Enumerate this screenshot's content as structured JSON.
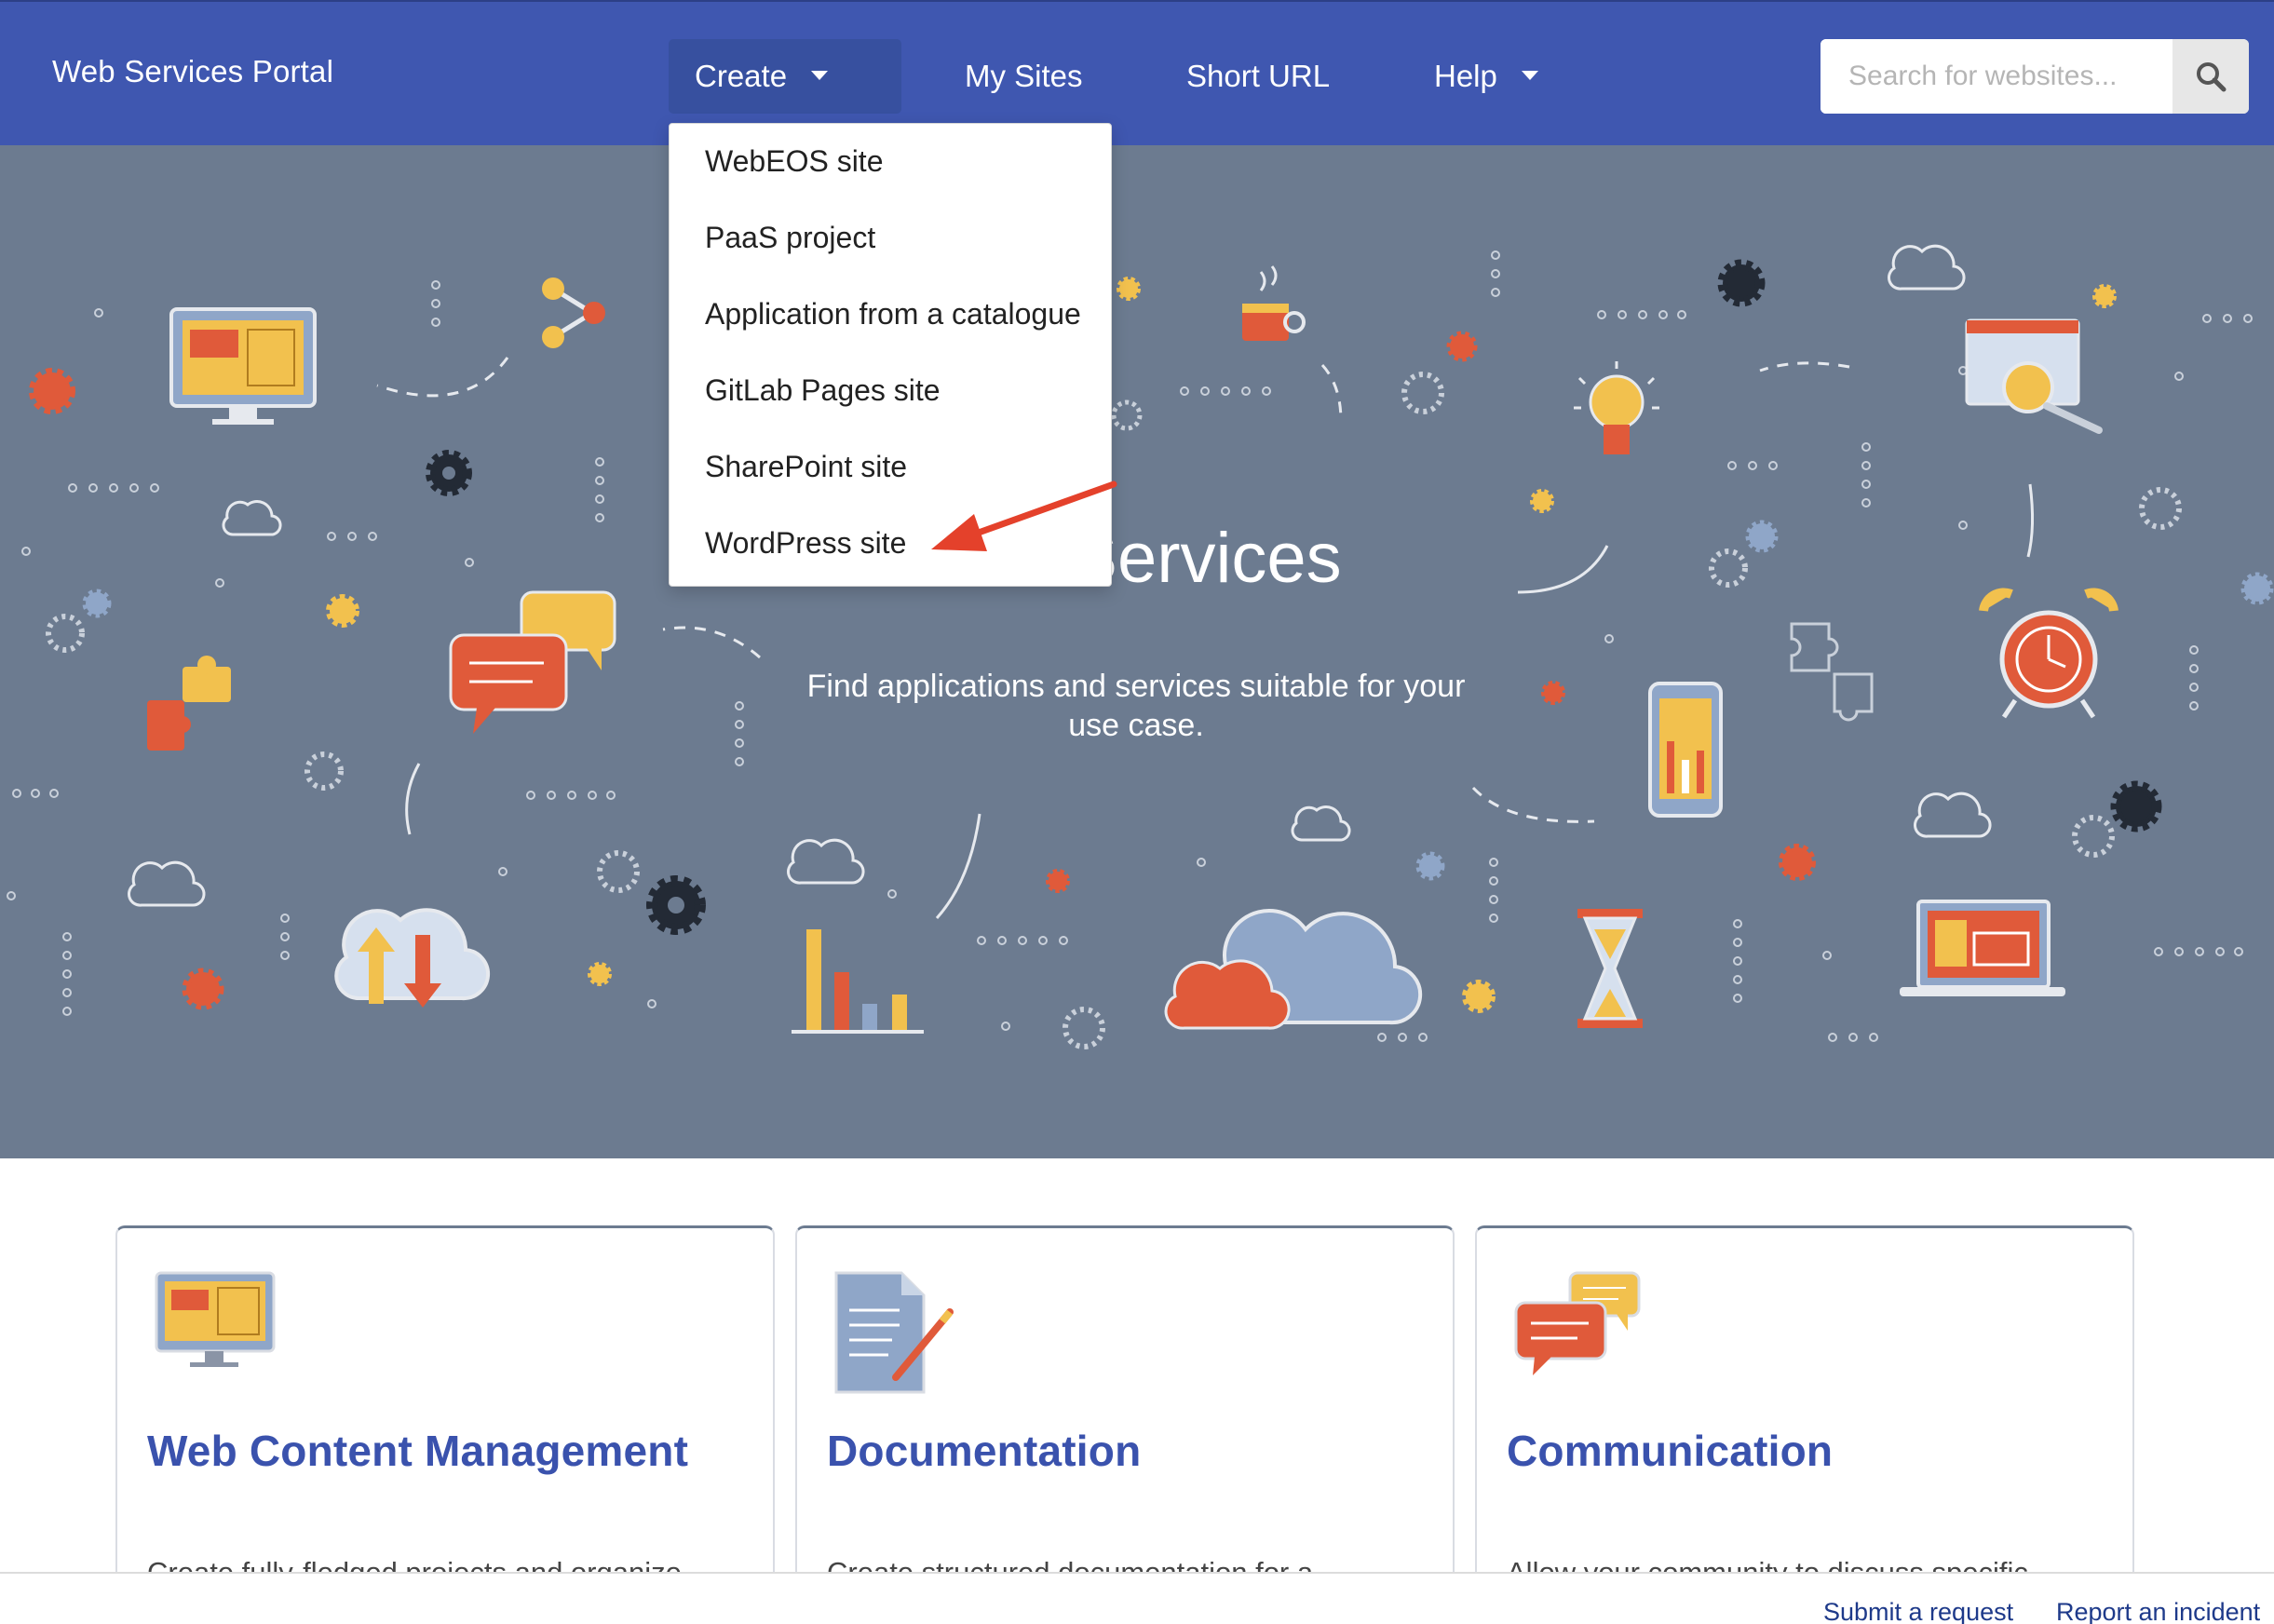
{
  "navbar": {
    "brand": "Web Services Portal",
    "items": [
      {
        "label": "Create",
        "has_caret": true
      },
      {
        "label": "My Sites"
      },
      {
        "label": "Short URL"
      },
      {
        "label": "Help",
        "has_caret": true
      }
    ],
    "search": {
      "placeholder": "Search for websites...",
      "icon": "search-icon"
    }
  },
  "create_menu": {
    "open": true,
    "items": [
      {
        "label": "WebEOS site"
      },
      {
        "label": "PaaS project"
      },
      {
        "label": "Application from a catalogue"
      },
      {
        "label": "GitLab Pages site"
      },
      {
        "label": "SharePoint site"
      },
      {
        "label": "WordPress site"
      }
    ],
    "highlight_arrow_color": "#e4412b"
  },
  "hero": {
    "title": "and Services",
    "subtitle": "Find applications and services suitable for your use case.",
    "background_color": "#6c7b90"
  },
  "cards": [
    {
      "title": "Web Content Management",
      "description": "Create fully-fledged projects and organize",
      "icon": "monitor-icon"
    },
    {
      "title": "Documentation",
      "description": "Create structured documentation for a",
      "icon": "document-pen-icon"
    },
    {
      "title": "Communication",
      "description": "Allow your community to discuss specific",
      "icon": "chat-bubbles-icon"
    }
  ],
  "footer": {
    "links": [
      "Submit a request",
      "Report an incident"
    ]
  },
  "colors": {
    "navbar": "#3f57b0",
    "link": "#3a52ad",
    "accent_orange": "#e8573a",
    "accent_yellow": "#f2c14e"
  }
}
